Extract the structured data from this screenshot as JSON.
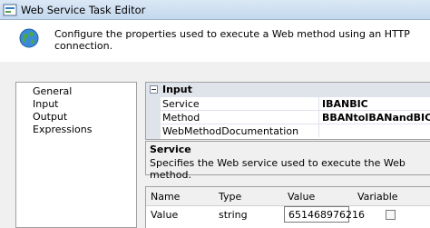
{
  "window": {
    "title": "Web Service Task Editor",
    "icon": "web-service-icon"
  },
  "header": {
    "icon": "globe-icon",
    "text": "Configure the properties used to execute a Web method using an HTTP connection."
  },
  "nav": {
    "items": [
      {
        "label": "General"
      },
      {
        "label": "Input"
      },
      {
        "label": "Output"
      },
      {
        "label": "Expressions"
      }
    ]
  },
  "property_grid": {
    "category": "Input",
    "rows": [
      {
        "name": "Service",
        "value": "IBANBIC"
      },
      {
        "name": "Method",
        "value": "BBANtoIBANandBIC"
      },
      {
        "name": "WebMethodDocumentation",
        "value": ""
      }
    ]
  },
  "description": {
    "title": "Service",
    "text": "Specifies the Web service used to execute the Web method."
  },
  "params_table": {
    "columns": [
      "Name",
      "Type",
      "Value",
      "Variable"
    ],
    "rows": [
      {
        "name": "Value",
        "type": "string",
        "value": "651468976216",
        "variable": false
      }
    ]
  }
}
